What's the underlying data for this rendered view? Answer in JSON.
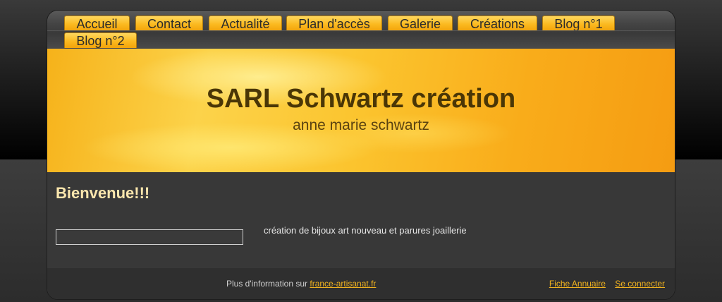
{
  "nav": {
    "items": [
      {
        "label": "Accueil"
      },
      {
        "label": "Contact"
      },
      {
        "label": "Actualité"
      },
      {
        "label": "Plan d'accès"
      },
      {
        "label": "Galerie"
      },
      {
        "label": "Créations"
      },
      {
        "label": "Blog n°1"
      },
      {
        "label": "Blog n°2"
      }
    ]
  },
  "banner": {
    "title": "SARL Schwartz création",
    "subtitle": "anne marie schwartz"
  },
  "content": {
    "heading": "Bienvenue!!!",
    "description": "création de bijoux art nouveau et parures joaillerie"
  },
  "footer": {
    "info_text": "Plus d'information sur",
    "info_link": "france-artisanat.fr",
    "links": [
      {
        "label": "Fiche Annuaire"
      },
      {
        "label": "Se connecter"
      }
    ]
  },
  "colors": {
    "accent": "#fbb91f",
    "heading": "#fbe6ad",
    "link": "#f0b21f"
  }
}
